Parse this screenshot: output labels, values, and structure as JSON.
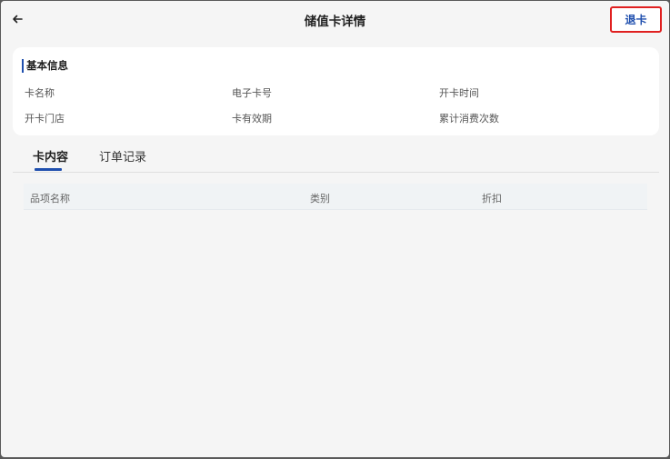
{
  "header": {
    "title": "储值卡详情",
    "back_icon": "arrow-left-icon",
    "refund_label": "退卡",
    "accent_color": "#1f4fae",
    "highlight_color": "#e02020"
  },
  "basic_info": {
    "title": "基本信息",
    "fields": [
      "卡名称",
      "电子卡号",
      "开卡时间",
      "开卡门店",
      "卡有效期",
      "累计消费次数"
    ]
  },
  "tabs": [
    {
      "label": "卡内容",
      "active": true
    },
    {
      "label": "订单记录",
      "active": false
    }
  ],
  "table": {
    "columns": [
      "品项名称",
      "类别",
      "折扣"
    ],
    "rows": []
  }
}
